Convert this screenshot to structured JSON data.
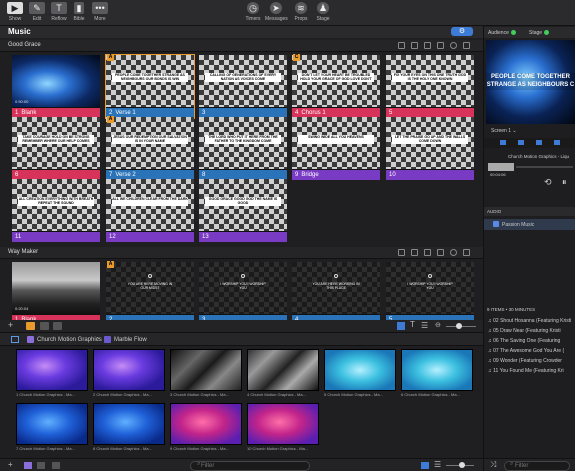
{
  "toolbar": {
    "left": [
      {
        "label": "Show",
        "icon": "play-icon"
      },
      {
        "label": "Edit",
        "icon": "pencil-icon"
      },
      {
        "label": "Reflow",
        "icon": "reflow-icon"
      },
      {
        "label": "Bible",
        "icon": "bible-icon"
      },
      {
        "label": "More",
        "icon": "more-icon"
      }
    ],
    "center": [
      {
        "label": "Timers",
        "icon": "timer-icon"
      },
      {
        "label": "Messages",
        "icon": "messages-icon"
      },
      {
        "label": "Props",
        "icon": "props-icon"
      },
      {
        "label": "Stage",
        "icon": "stage-icon"
      }
    ]
  },
  "library": {
    "title": "Music",
    "gear": "⚙"
  },
  "songs": [
    {
      "title": "Good Grace",
      "slides": [
        {
          "num": "1",
          "label": "Blank",
          "color": "#d6325a",
          "badge": "",
          "kind": "blue",
          "timecode": "0:50:00",
          "text": ""
        },
        {
          "num": "2",
          "label": "Verse 1",
          "color": "#2a73b8",
          "badge": "A",
          "kind": "checker",
          "text": "PEOPLE COME TOGETHER STRANGE AS NEIGHBOURS OUR BONDS IS WIN",
          "selected": true
        },
        {
          "num": "3",
          "label": "",
          "color": "#2a73b8",
          "badge": "",
          "kind": "checker",
          "text": "CALLING OF GENERATIONS OF EVERY NATION AS VOICES COME"
        },
        {
          "num": "4",
          "label": "Chorus 1",
          "color": "#d6325a",
          "badge": "C",
          "kind": "checker",
          "text": "DON'T LET YOUR HEART BE TROUBLED HOLD YOUR GRACE OF GOD LOVE DON'T"
        },
        {
          "num": "5",
          "label": "",
          "color": "#d6325a",
          "badge": "",
          "kind": "checker",
          "text": "FIX YOUR EYES ON THIS ONE TRUTH GOD IS THE HOLY ONE KNOWN"
        },
        {
          "num": "6",
          "label": "",
          "color": "#d6325a",
          "badge": "",
          "kind": "checker",
          "text": "TAKE COURAGE HOLD ON BE STRONG REMEMBER WHERE OUR HELP COMES FROM"
        },
        {
          "num": "7",
          "label": "Verse 2",
          "color": "#2a73b8",
          "badge": "A",
          "kind": "checker",
          "text": "JESUS OUR REDEMPTION OUR SALVATION IS IN YOUR NAME"
        },
        {
          "num": "8",
          "label": "",
          "color": "#2a73b8",
          "badge": "",
          "kind": "checker",
          "text": "THE LORD WHO PUT IT HERE FROM THE FATHER TO THE KINGDOM COME"
        },
        {
          "num": "9",
          "label": "Bridge",
          "color": "#7a3bc4",
          "badge": "",
          "kind": "checker",
          "text": "SWING WIDE ALL YOU HEAVENS"
        },
        {
          "num": "10",
          "label": "",
          "color": "#7a3bc4",
          "badge": "",
          "kind": "checker",
          "text": "LET THE PRAISE GO UP AND THE WALLS COME DOWN"
        },
        {
          "num": "11",
          "label": "",
          "color": "#7a3bc4",
          "badge": "",
          "kind": "checker",
          "text": "ALL CREATION EVERYTHING WITH BREATH REPEAT THE SOUND"
        },
        {
          "num": "12",
          "label": "",
          "color": "#7a3bc4",
          "badge": "",
          "kind": "checker",
          "text": "ALL WE CHILDREN CLEAR FROM THE DARK"
        },
        {
          "num": "13",
          "label": "",
          "color": "#7a3bc4",
          "badge": "",
          "kind": "checker",
          "text": "GOOD GRACE GOOD GOD THE NAME IS GOOD"
        }
      ]
    },
    {
      "title": "Way Maker",
      "slides": [
        {
          "num": "1",
          "label": "Blank",
          "color": "#d6325a",
          "badge": "",
          "kind": "mtn",
          "timecode": "0:20:04",
          "text": ""
        },
        {
          "num": "2",
          "label": "",
          "color": "#2a73b8",
          "badge": "A",
          "kind": "dark",
          "text": "YOU ARE HERE MOVING IN OUR MIDST"
        },
        {
          "num": "3",
          "label": "",
          "color": "#2a73b8",
          "badge": "",
          "kind": "dark",
          "text": "I WORSHIP YOU I WORSHIP YOU"
        },
        {
          "num": "4",
          "label": "",
          "color": "#2a73b8",
          "badge": "",
          "kind": "dark",
          "text": "YOU ARE HERE WORKING IN THIS PLACE"
        },
        {
          "num": "5",
          "label": "",
          "color": "#2a73b8",
          "badge": "",
          "kind": "dark",
          "text": "I WORSHIP YOU I WORSHIP YOU"
        }
      ]
    }
  ],
  "media": {
    "breadcrumb": [
      "Church Motion Graphics",
      "Marble Flow"
    ],
    "items": [
      {
        "label": "1 Church Motion Graphics - Ma...",
        "style": "v1"
      },
      {
        "label": "2 Church Motion Graphics - Ma...",
        "style": "v1"
      },
      {
        "label": "3 Church Motion Graphics - Ma...",
        "style": "g1"
      },
      {
        "label": "4 Church Motion Graphics - Ma...",
        "style": "g2"
      },
      {
        "label": "5 Church Motion Graphics - Ma...",
        "style": "c1"
      },
      {
        "label": "6 Church Motion Graphics - Ma...",
        "style": "c1"
      },
      {
        "label": "7 Church Motion Graphics - Ma...",
        "style": "b1"
      },
      {
        "label": "8 Church Motion Graphics - Ma...",
        "style": "b1"
      },
      {
        "label": "9 Church Motion Graphics - Ma...",
        "style": "p1"
      },
      {
        "label": "10 Church Motion Graphics - Ma...",
        "style": "p1"
      }
    ],
    "filter_placeholder": "Filter"
  },
  "right": {
    "audience": "Audience",
    "stage": "Stage",
    "preview_line1": "PEOPLE COME TOGETHER",
    "preview_line2": "STRANGE AS NEIGHBOURS C",
    "screen": "Screen 1",
    "now_playing": "Church Motion Graphics - Liqu",
    "time": "00:04:06",
    "audio_header": "AUDIO",
    "audio_item": "Passion Music",
    "playlist_summary": "9 ITEMS • 30 MINUTES",
    "playlist": [
      "02 Shout Hosanna (Featuring Kristi",
      "05 Draw Near (Featuring Kristi",
      "06 The Saving One (Featuring",
      "07 The Awesome God You Are (",
      "09 Wonder (Featuring Crowder",
      "11 You Found Me (Featuring Kri"
    ],
    "filter_placeholder": "Filter"
  },
  "colors": {
    "accent": "#3d7bd6",
    "red": "#d6325a",
    "blue": "#2a73b8",
    "purple": "#7a3bc4",
    "selected": "#e89a2c"
  }
}
